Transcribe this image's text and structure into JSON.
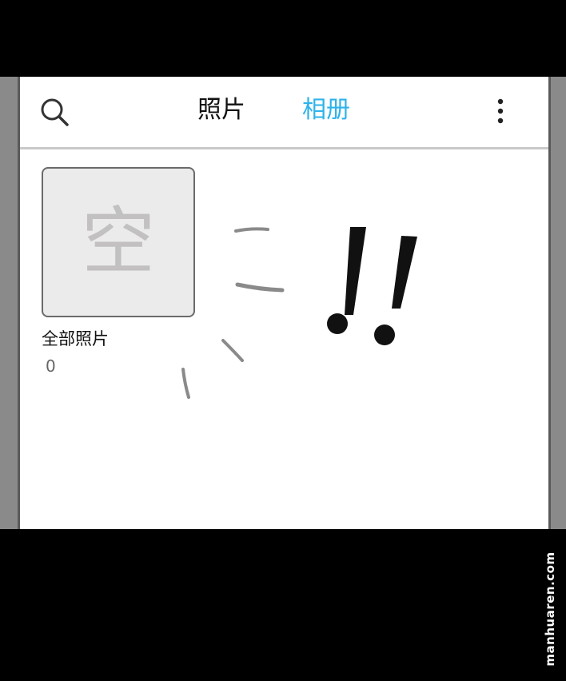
{
  "tabs": {
    "photos": "照片",
    "albums": "相册"
  },
  "active_tab": "albums",
  "accent_color": "#2eb3ea",
  "icons": {
    "search": "search-icon",
    "more": "more-vertical-icon"
  },
  "albums": [
    {
      "thumb_char": "空",
      "name": "全部照片",
      "count": "0"
    }
  ],
  "exclamation": "!!",
  "watermark": "manhuaren.com"
}
